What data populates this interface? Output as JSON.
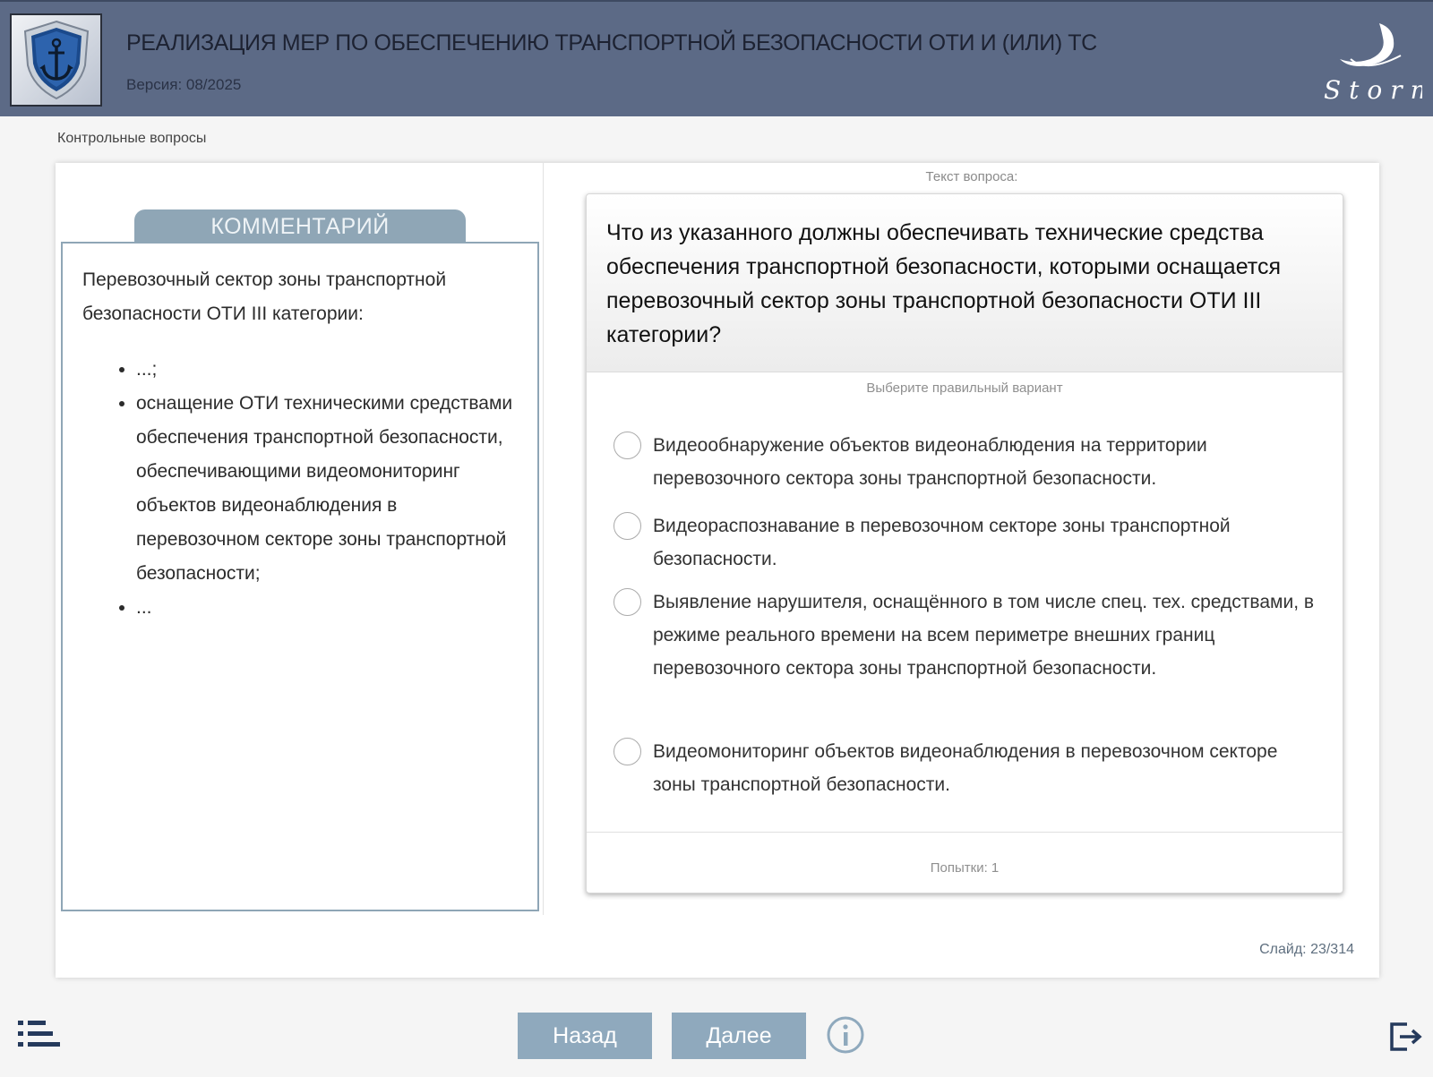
{
  "header": {
    "title": "РЕАЛИЗАЦИЯ МЕР ПО ОБЕСПЕЧЕНИЮ ТРАНСПОРТНОЙ БЕЗОПАСНОСТИ ОТИ И (ИЛИ) ТС",
    "version": "Версия: 08/2025",
    "logo_icon": "anchor-shield-icon",
    "brand_name": "Storm"
  },
  "breadcrumb": "Контрольные вопросы",
  "comment": {
    "tab_label": "КОММЕНТАРИЙ",
    "intro": "Перевозочный сектор зоны транспортной безопасности ОТИ III категории:",
    "items": [
      "...;",
      "оснащение ОТИ техническими средствами обеспечения транспортной безопасности, обеспечивающими видеомониторинг объектов видеонаблюдения в перевозочном секторе зоны транспортной безопасности;",
      "..."
    ]
  },
  "question": {
    "caption": "Текст вопроса:",
    "text": "Что из указанного должны обеспечивать технические средства обеспечения транспортной безопасности, которыми оснащается перевозочный сектор зоны транспортной безопасности ОТИ III категории?",
    "hint": "Выберите правильный вариант",
    "options": [
      "Видеообнаружение объектов видеонаблюдения на территории перевозочного сектора зоны транспортной безопасности.",
      "Видеораспознавание в перевозочном секторе зоны транспортной безопасности.",
      "Выявление нарушителя, оснащённого в том числе спец. тех. средствами, в режиме реального времени на всем периметре внешних границ перевозочного сектора зоны транспортной безопасности.",
      "Видеомониторинг объектов видеонаблюдения в перевозочном секторе зоны транспортной безопасности."
    ],
    "attempts": "Попытки: 1"
  },
  "slide_counter": "Слайд: 23/314",
  "footer": {
    "back_label": "Назад",
    "next_label": "Далее",
    "menu_icon": "list-menu-icon",
    "info_icon": "info-icon",
    "exit_icon": "exit-icon"
  },
  "colors": {
    "header_bg": "#5c6a86",
    "accent": "#8fa9bd",
    "page_bg": "#f5f5f5"
  }
}
